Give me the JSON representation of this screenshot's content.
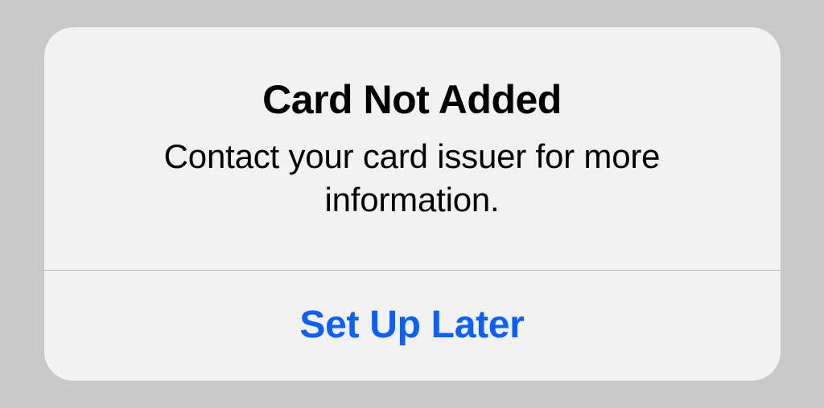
{
  "alert": {
    "title": "Card Not Added",
    "message": "Contact your card issuer for more information.",
    "button_label": "Set Up Later"
  }
}
